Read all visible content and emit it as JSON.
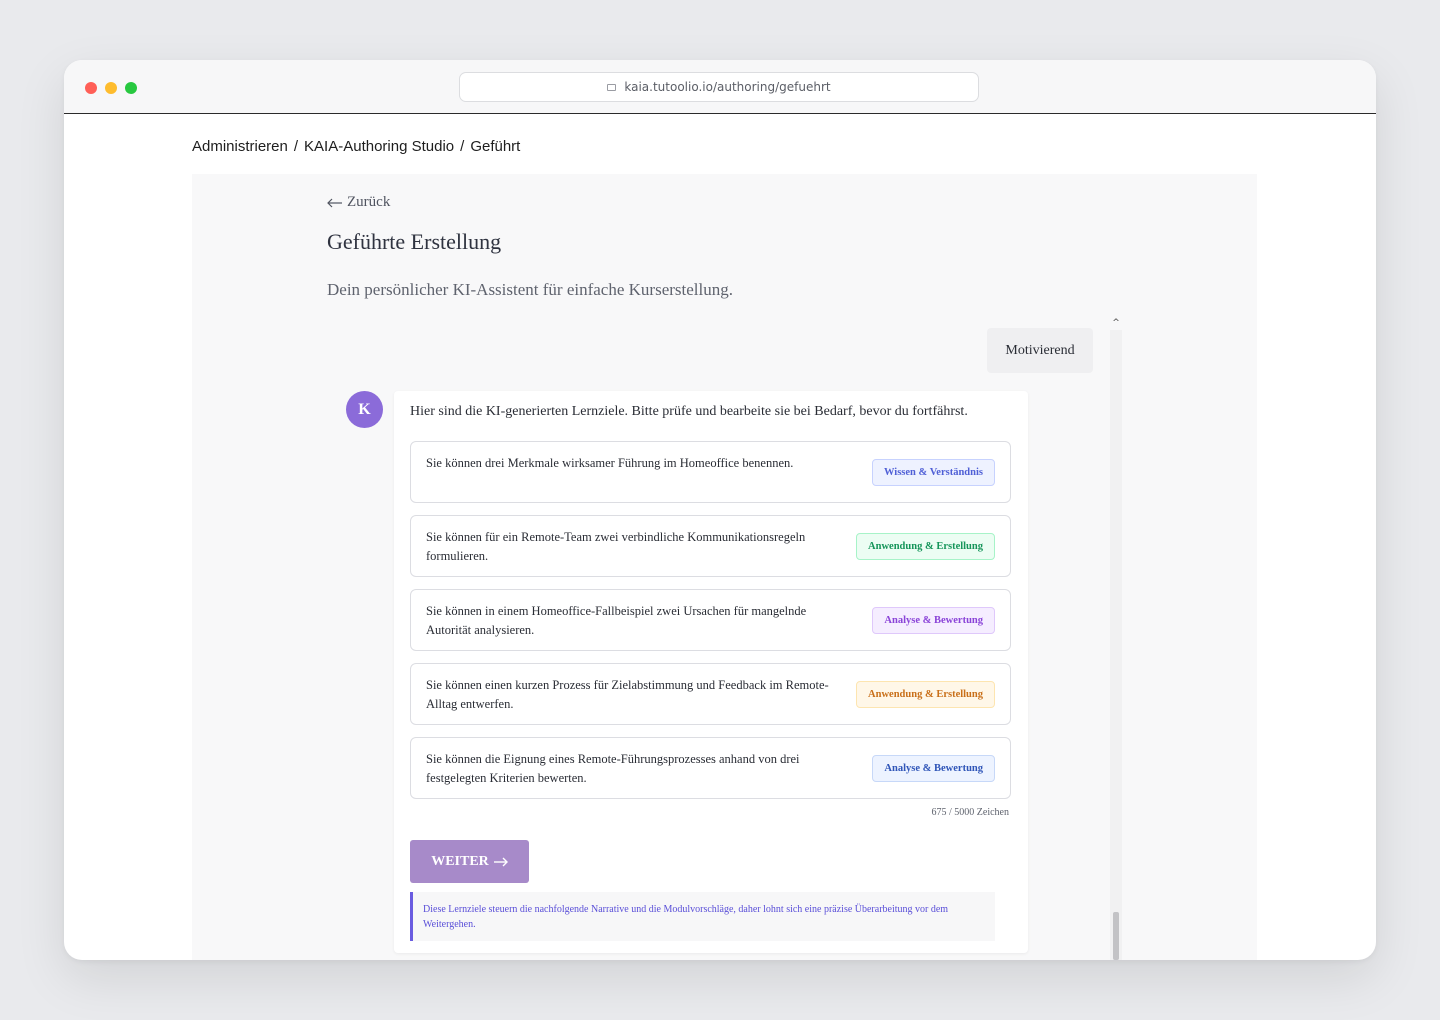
{
  "browser": {
    "url": "kaia.tutoolio.io/authoring/gefuehrt",
    "url_icon": "page-icon"
  },
  "breadcrumb": {
    "items": [
      "Administrieren",
      "KAIA-Authoring Studio",
      "Geführt"
    ],
    "separator": "/"
  },
  "page": {
    "back_label": "Zurück",
    "back_icon": "arrow-left-icon",
    "title": "Geführte Erstellung",
    "subtitle": "Dein persönlicher KI-Assistent für einfache Kurserstellung."
  },
  "chat": {
    "user_message": "Motivierend",
    "assistant_avatar": "K",
    "assistant_intro": "Hier sind die KI-generierten Lernziele. Bitte prüfe und bearbeite sie bei Bedarf, bevor du fortfährst.",
    "objectives": [
      {
        "text": "Sie können drei Merkmale wirksamer Führung im Homeoffice benennen.",
        "tag": "Wissen & Verständnis",
        "tag_color": "#4f5fd6"
      },
      {
        "text": "Sie können für ein Remote-Team zwei verbindliche Kommunikationsregeln formulieren.",
        "tag": "Anwendung & Erstellung",
        "tag_color": "#16955a"
      },
      {
        "text": "Sie können in einem Homeoffice-Fallbeispiel zwei Ursachen für mangelnde Autorität analysieren.",
        "tag": "Analyse & Bewertung",
        "tag_color": "#8a43d8"
      },
      {
        "text": "Sie können einen kurzen Prozess für Zielabstimmung und Feedback im Remote-Alltag entwerfen.",
        "tag": "Anwendung & Erstellung",
        "tag_color": "#c9701a"
      },
      {
        "text": "Sie können die Eignung eines Remote-Führungsprozesses anhand von drei festgelegten Kriterien bewerten.",
        "tag": "Analyse & Bewertung",
        "tag_color": "#2f55b8"
      }
    ],
    "char_counter": "675 / 5000 Zeichen",
    "next_button": "WEITER",
    "next_icon": "arrow-right-icon",
    "hint": "Diese Lernziele steuern die nachfolgende Narrative und die Modulvorschläge, daher lohnt sich eine präzise Überarbeitung vor dem Weitergehen."
  },
  "colors": {
    "accent": "#8b6bd9",
    "button": "#a78ac9",
    "hint_border": "#6a5ce0"
  }
}
